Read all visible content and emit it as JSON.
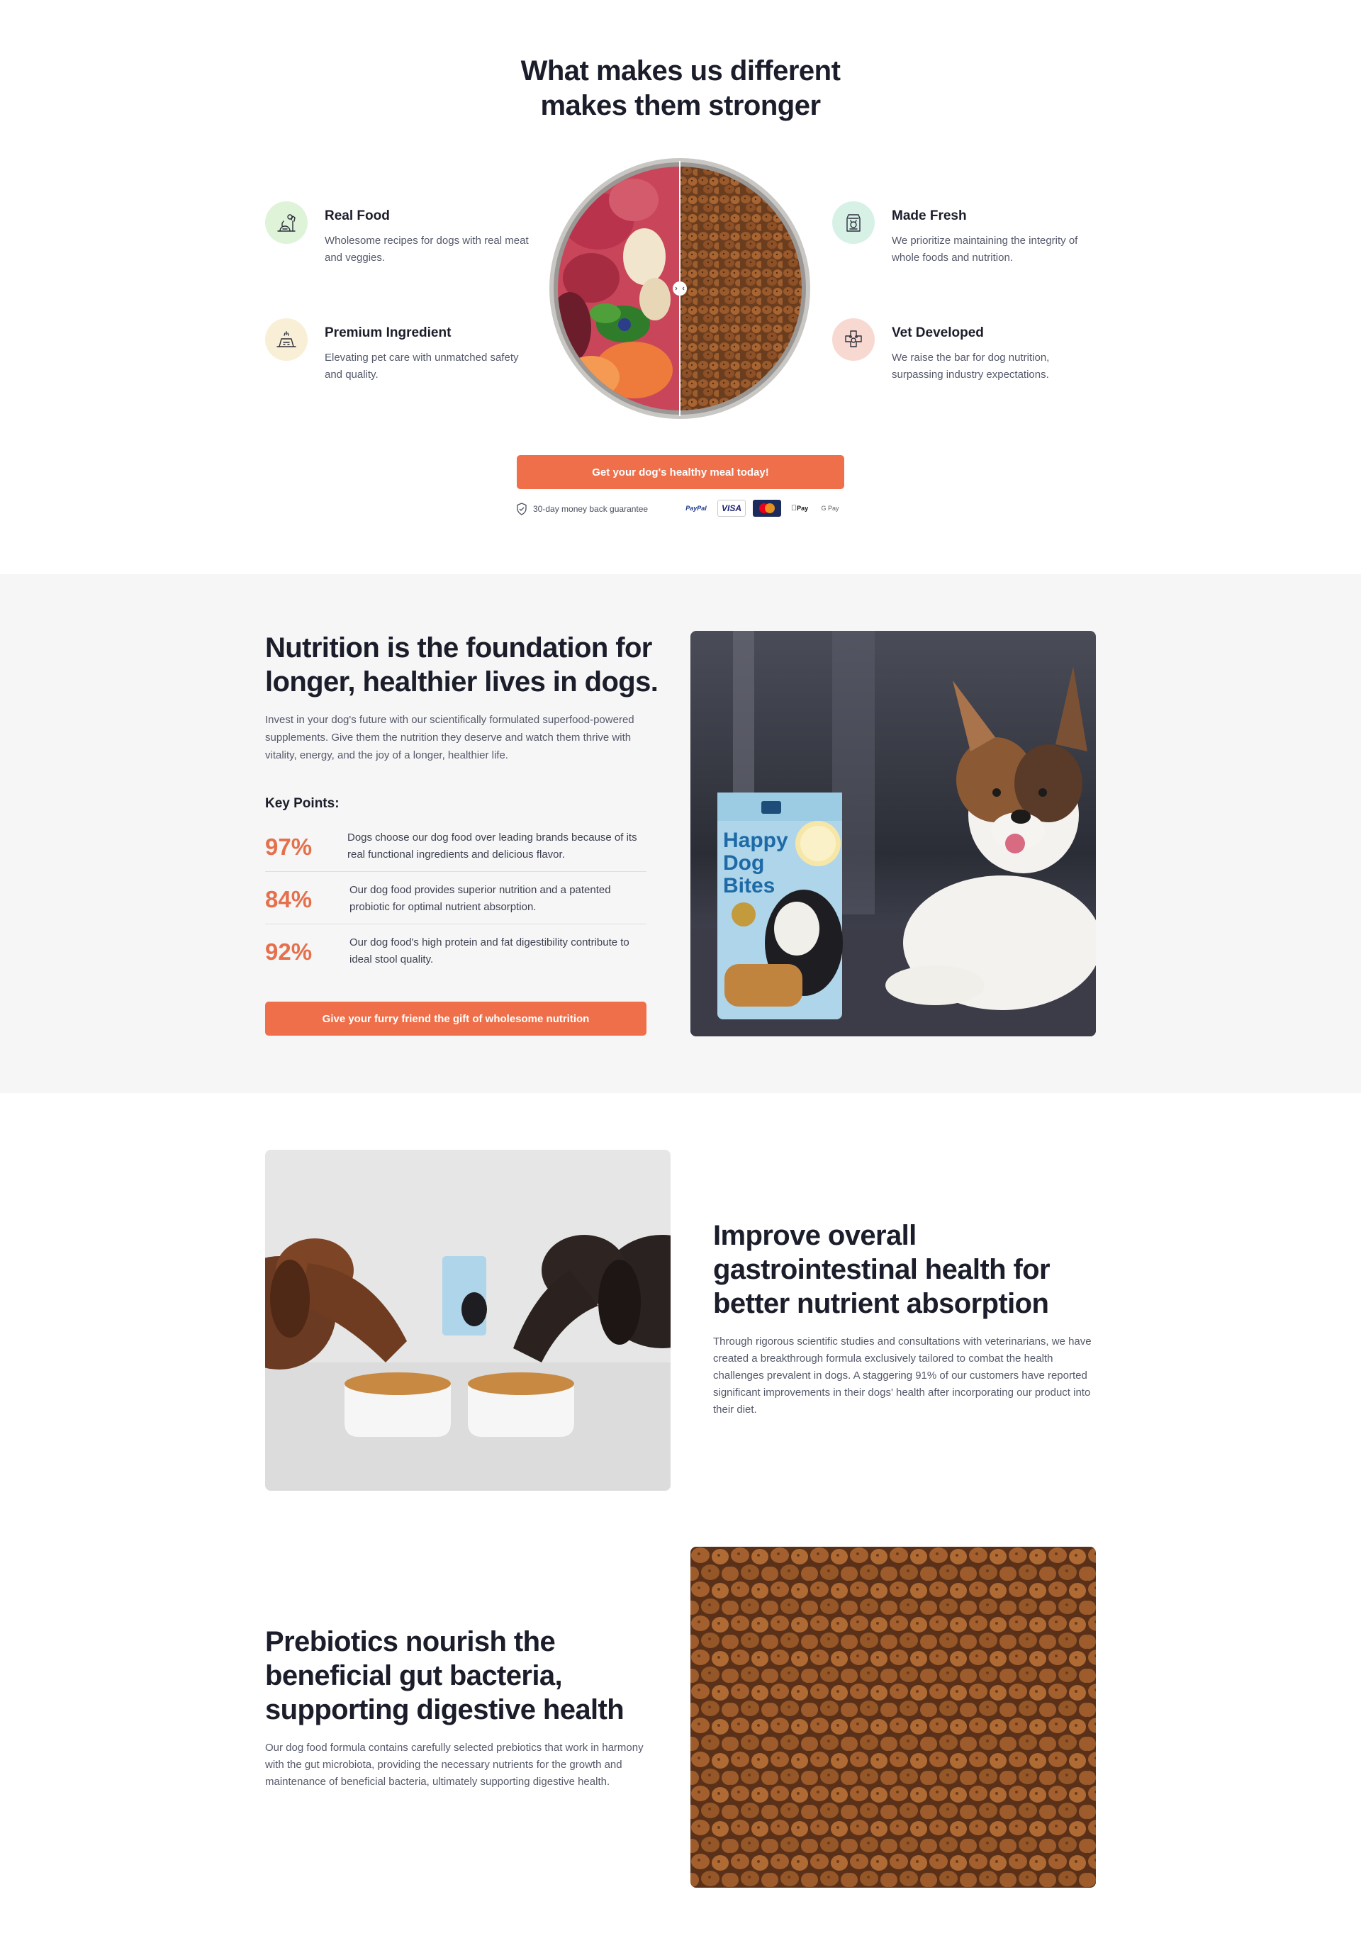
{
  "hero": {
    "title_line1": "What makes us different",
    "title_line2": "makes them stronger"
  },
  "features": [
    {
      "title": "Real Food",
      "description": "Wholesome recipes for dogs with real meat and veggies.",
      "icon": "dog-with-food-icon",
      "color": "#dff3d9"
    },
    {
      "title": "Premium Ingredient",
      "description": "Elevating pet care with unmatched safety and quality.",
      "icon": "food-bowl-icon",
      "color": "#f8efd6"
    },
    {
      "title": "Made Fresh",
      "description": "We prioritize maintaining the integrity of whole foods and nutrition.",
      "icon": "food-bag-icon",
      "color": "#d7f1e7"
    },
    {
      "title": "Vet Developed",
      "description": "We raise the bar for dog nutrition, surpassing industry expectations.",
      "icon": "vet-paw-icon",
      "color": "#f8d9d2"
    }
  ],
  "cta_primary": "Get your dog's healthy meal today!",
  "guarantee": "30-day money back guarantee",
  "payments": [
    "PayPal",
    "VISA",
    "Mastercard",
    "Pay",
    "G Pay"
  ],
  "nutrition": {
    "title": "Nutrition is the foundation for longer, healthier lives in dogs.",
    "description": "Invest in your dog's future with our scientifically formulated superfood-powered supplements. Give them the nutrition they deserve and watch them thrive with vitality, energy, and the joy of a longer, healthier life.",
    "key_points_label": "Key Points:",
    "key_points": [
      {
        "value": "97%",
        "text": "Dogs choose our dog food over leading brands because of its real functional ingredients and delicious flavor."
      },
      {
        "value": "84%",
        "text": "Our dog food provides superior nutrition and a patented probiotic for optimal nutrient absorption."
      },
      {
        "value": "92%",
        "text": "Our dog food's high protein and fat digestibility contribute to ideal stool quality."
      }
    ],
    "cta": "Give your furry friend the gift of wholesome nutrition",
    "bag_text_1": "Happy",
    "bag_text_2": "Dog",
    "bag_text_3": "Bites"
  },
  "gut": {
    "title": "Improve overall gastrointestinal health for better nutrient absorption",
    "description": "Through rigorous scientific studies and consultations with veterinarians, we have created a breakthrough formula exclusively tailored to combat the health challenges prevalent in dogs. A staggering 91% of our customers have reported significant improvements in their dogs' health after incorporating our product into their diet."
  },
  "prebiotics": {
    "title": "Prebiotics nourish the beneficial gut bacteria, supporting digestive health",
    "description": "Our dog food formula contains carefully selected prebiotics that work in harmony with the gut microbiota, providing the necessary nutrients for the growth and maintenance of beneficial bacteria, ultimately supporting digestive health."
  },
  "colors": {
    "accent": "#ee6f4a",
    "stat": "#e5704b",
    "heading": "#1b1d2a",
    "body": "#55596a",
    "band": "#f6f6f6"
  }
}
